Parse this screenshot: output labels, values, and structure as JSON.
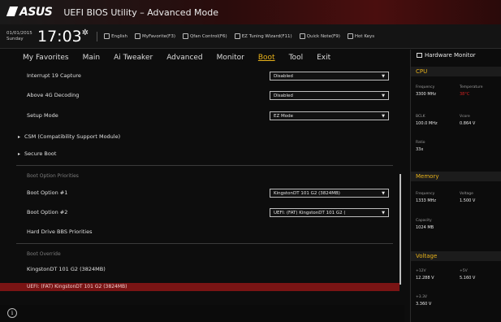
{
  "titlebar": {
    "brand": "ASUS",
    "title": "UEFI BIOS Utility – Advanced Mode"
  },
  "infobar": {
    "date": "01/01/2015",
    "day": "Sunday",
    "time": "17:03",
    "items": [
      "English",
      "MyFavorite(F3)",
      "Qfan Control(F6)",
      "EZ Tuning Wizard(F11)",
      "Quick Note(F9)",
      "Hot Keys"
    ]
  },
  "menu": {
    "items": [
      "My Favorites",
      "Main",
      "Ai Tweaker",
      "Advanced",
      "Monitor",
      "Boot",
      "Tool",
      "Exit"
    ],
    "active": "Boot"
  },
  "settings": {
    "interrupt19": {
      "label": "Interrupt 19 Capture",
      "value": "Disabled"
    },
    "above4g": {
      "label": "Above 4G Decoding",
      "value": "Disabled"
    },
    "setup_mode": {
      "label": "Setup Mode",
      "value": "EZ Mode"
    },
    "csm": "CSM (Compatibility Support Module)",
    "secure_boot": "Secure Boot",
    "boot_priorities": "Boot Option Priorities",
    "boot1": {
      "label": "Boot Option #1",
      "value": "KingstonDT 101 G2  (3824MB)"
    },
    "boot2": {
      "label": "Boot Option #2",
      "value": "UEFI: (FAT) KingstonDT 101 G2 ("
    },
    "hdd_bbs": "Hard Drive BBS Priorities",
    "boot_override": "Boot Override",
    "override1": "KingstonDT 101 G2  (3824MB)",
    "override2": "UEFI: (FAT) KingstonDT 101 G2 (3824MB)"
  },
  "hwm": {
    "title": "Hardware Monitor",
    "cpu": {
      "section": "CPU",
      "frequency_label": "Frequency",
      "frequency": "3300 MHz",
      "temperature_label": "Temperature",
      "temperature": "38°C",
      "bclk_label": "BCLK",
      "bclk": "100.0 MHz",
      "vcore_label": "Vcore",
      "vcore": "0.864 V",
      "ratio_label": "Ratio",
      "ratio": "33x"
    },
    "memory": {
      "section": "Memory",
      "frequency_label": "Frequency",
      "frequency": "1333 MHz",
      "voltage_label": "Voltage",
      "voltage": "1.500 V",
      "capacity_label": "Capacity",
      "capacity": "1024 MB"
    },
    "voltage": {
      "section": "Voltage",
      "v12_label": "+12V",
      "v12": "12.288 V",
      "v5_label": "+5V",
      "v5": "5.160 V",
      "v33_label": "+3.3V",
      "v33": "3.360 V"
    }
  },
  "colors": {
    "accent": "#e8b21a",
    "highlight": "#7a1414",
    "alert": "#d02020"
  },
  "footer": {
    "info_icon": "i"
  }
}
